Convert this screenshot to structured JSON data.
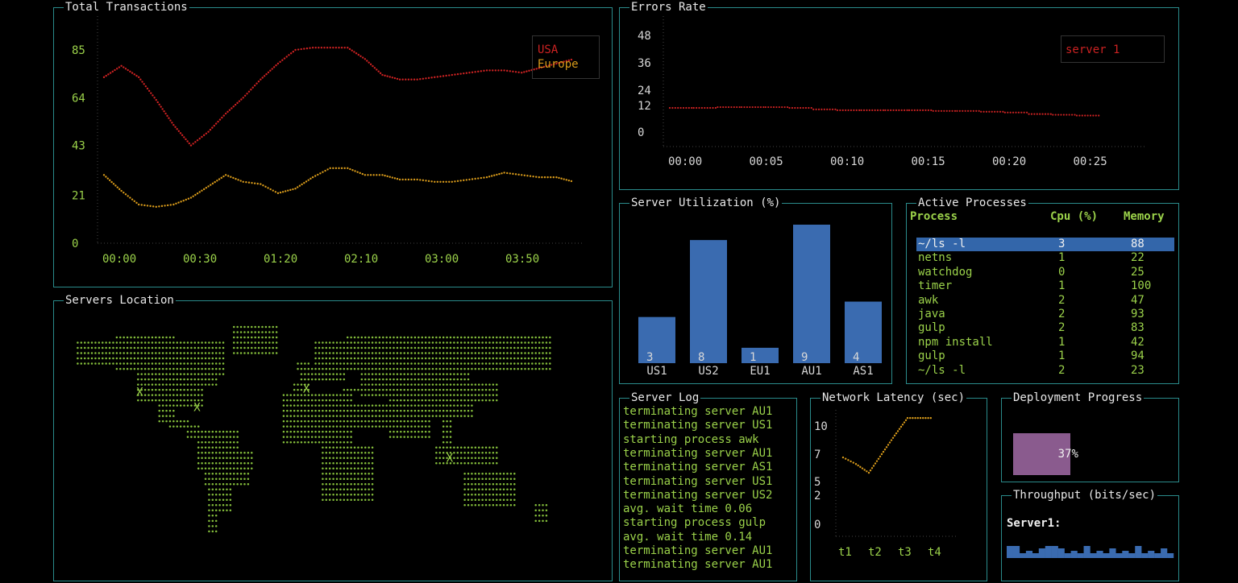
{
  "colors": {
    "border": "#2a8b8b",
    "usa": "#cc2222",
    "europe": "#d89a1a",
    "green": "#9bd24a",
    "bar": "#3a6bb0",
    "progress": "#8a5b8e"
  },
  "transactions": {
    "title": "Total Transactions",
    "legend": [
      "USA",
      "Europe"
    ],
    "chart_data": {
      "type": "line",
      "x": [
        "00:00",
        "00:30",
        "01:20",
        "02:10",
        "03:00",
        "03:50"
      ],
      "y_ticks": [
        0,
        21,
        43,
        64,
        85
      ],
      "ylim": [
        0,
        85
      ],
      "series": [
        {
          "name": "USA",
          "values": [
            73,
            78,
            73,
            63,
            52,
            43,
            49,
            57,
            64,
            72,
            79,
            85,
            86,
            86,
            86,
            81,
            74,
            72,
            72,
            73,
            74,
            75,
            76,
            76,
            75,
            77,
            79,
            81
          ]
        },
        {
          "name": "Europe",
          "values": [
            30,
            23,
            17,
            16,
            17,
            20,
            25,
            30,
            27,
            26,
            22,
            24,
            29,
            33,
            33,
            30,
            30,
            28,
            28,
            27,
            27,
            28,
            29,
            31,
            30,
            29,
            29,
            27
          ]
        }
      ]
    }
  },
  "errors": {
    "title": "Errors Rate",
    "legend": [
      "server 1"
    ],
    "chart_data": {
      "type": "line",
      "x": [
        "00:00",
        "00:05",
        "00:10",
        "00:15",
        "00:20",
        "00:25"
      ],
      "y_ticks": [
        0,
        12,
        24,
        36,
        48
      ],
      "ylim": [
        0,
        48
      ],
      "series": [
        {
          "name": "server 1",
          "values": [
            18,
            18,
            19,
            19,
            19,
            18,
            16,
            15,
            15,
            15,
            15,
            14,
            14,
            13,
            12,
            10,
            9,
            8
          ]
        }
      ]
    }
  },
  "utilization": {
    "title": "Server Utilization (%)",
    "chart_data": {
      "type": "bar",
      "categories": [
        "US1",
        "US2",
        "EU1",
        "AU1",
        "AS1"
      ],
      "values": [
        3,
        8,
        1,
        9,
        4
      ],
      "ylim": [
        0,
        9
      ]
    }
  },
  "processes": {
    "title": "Active Processes",
    "headers": [
      "Process",
      "Cpu (%)",
      "Memory"
    ],
    "rows": [
      [
        "~/ls -l",
        "3",
        "88"
      ],
      [
        "netns",
        "1",
        "22"
      ],
      [
        "watchdog",
        "0",
        "25"
      ],
      [
        "timer",
        "1",
        "100"
      ],
      [
        "awk",
        "2",
        "47"
      ],
      [
        "java",
        "2",
        "93"
      ],
      [
        "gulp",
        "2",
        "83"
      ],
      [
        "npm install",
        "1",
        "42"
      ],
      [
        "gulp",
        "1",
        "94"
      ],
      [
        "~/ls -l",
        "2",
        "23"
      ]
    ]
  },
  "location": {
    "title": "Servers Location",
    "markers": [
      {
        "label": "X",
        "lat": 38,
        "lon": -122,
        "color": "#cc2222"
      },
      {
        "label": "X",
        "lat": 28,
        "lon": -80,
        "color": "#d89a1a"
      },
      {
        "label": "X",
        "lat": 40,
        "lon": 0,
        "color": "#cc2222"
      },
      {
        "label": "X",
        "lat": -5,
        "lon": 105,
        "color": "#cc2222"
      }
    ]
  },
  "log": {
    "title": "Server Log",
    "lines": [
      "terminating server AU1",
      "terminating server US1",
      "starting process awk",
      "terminating server AU1",
      "terminating server AS1",
      "terminating server US1",
      "terminating server US2",
      "avg. wait time 0.06",
      "starting process gulp",
      "avg. wait time 0.14",
      "terminating server AU1",
      "terminating server AU1"
    ]
  },
  "latency": {
    "title": "Network Latency (sec)",
    "chart_data": {
      "type": "line",
      "x": [
        "t1",
        "t2",
        "t3",
        "t4"
      ],
      "y_ticks": [
        0,
        2,
        5,
        7,
        10
      ],
      "ylim": [
        0,
        10
      ],
      "series": [
        {
          "values": [
            7.2,
            6.6,
            5.8,
            7.5,
            9.2,
            10.8,
            10.8,
            10.8
          ]
        }
      ]
    }
  },
  "deployment": {
    "title": "Deployment Progress",
    "percent": 37,
    "label": "37%"
  },
  "throughput": {
    "title": "Throughput (bits/sec)",
    "server_label": "Server1:",
    "chart_data": {
      "type": "bar",
      "values": [
        5,
        5,
        2,
        3,
        2,
        4,
        5,
        5,
        4,
        2,
        3,
        2,
        5,
        2,
        3,
        2,
        4,
        2,
        3,
        2,
        5,
        2,
        3,
        2,
        4,
        2
      ]
    }
  }
}
